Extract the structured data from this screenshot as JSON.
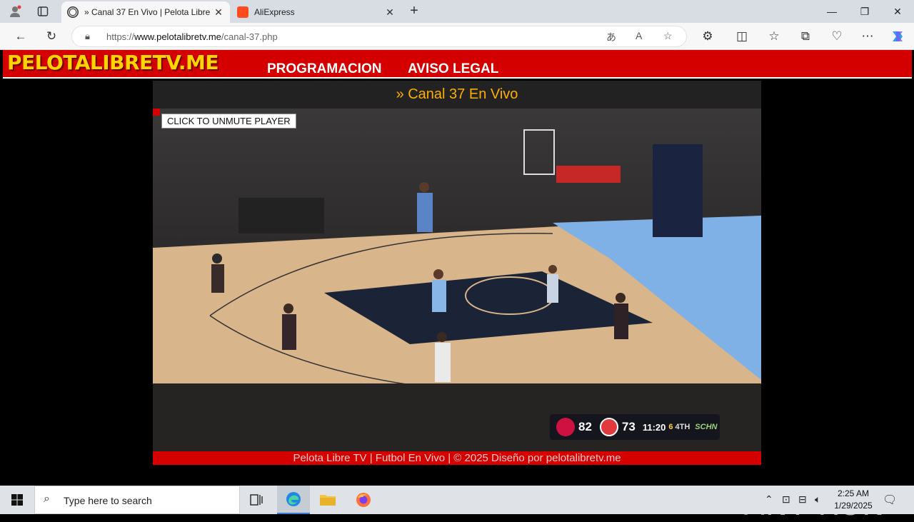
{
  "browser": {
    "tabs": [
      {
        "title": "» Canal 37 En Vivo | Pelota Libre TV",
        "icon": "soccer-ball-icon"
      },
      {
        "title": "AliExpress",
        "icon": "aliexpress-icon"
      }
    ],
    "address": {
      "scheme": "https://",
      "host": "www.pelotalibretv.me",
      "path": "/canal-37.php"
    }
  },
  "site": {
    "logo": "PELOTALIBRETV.ME",
    "menu": [
      "PROGRAMACION",
      "AVISO LEGAL"
    ],
    "page_title": "» Canal 37 En Vivo",
    "unmute_label": "CLICK TO UNMUTE PLAYER",
    "footer": "Pelota Libre TV | Futbol En Vivo | © 2025 Diseño por pelotalibretv.me"
  },
  "scorebug": {
    "away_score": "82",
    "home_score": "73",
    "clock": "11:20",
    "timeouts": "6",
    "quarter": "4TH",
    "network": "SCHN"
  },
  "watermark": "ANY RUN",
  "taskbar": {
    "search_placeholder": "Type here to search",
    "time": "2:25 AM",
    "date": "1/29/2025"
  },
  "colors": {
    "header_red": "#d40000",
    "logo_yellow": "#ffd400",
    "title_orange": "#ffae00"
  }
}
